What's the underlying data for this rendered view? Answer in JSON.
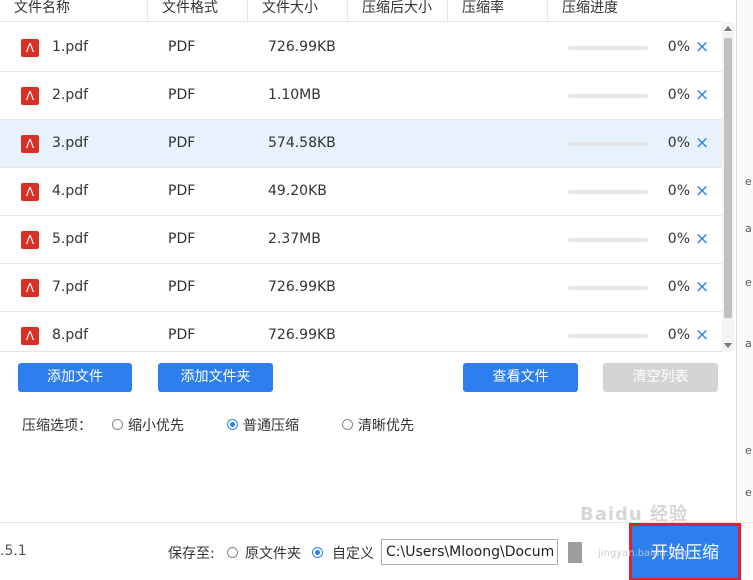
{
  "table": {
    "headers": [
      "文件名称",
      "文件格式",
      "文件大小",
      "压缩后大小",
      "压缩率",
      "压缩进度"
    ],
    "rows": [
      {
        "icon": "pdf-icon",
        "name": "1.pdf",
        "format": "PDF",
        "size": "726.99KB",
        "progress": "0%",
        "selected": false
      },
      {
        "icon": "pdf-icon",
        "name": "2.pdf",
        "format": "PDF",
        "size": "1.10MB",
        "progress": "0%",
        "selected": false
      },
      {
        "icon": "pdf-icon",
        "name": "3.pdf",
        "format": "PDF",
        "size": "574.58KB",
        "progress": "0%",
        "selected": true
      },
      {
        "icon": "pdf-icon",
        "name": "4.pdf",
        "format": "PDF",
        "size": "49.20KB",
        "progress": "0%",
        "selected": false
      },
      {
        "icon": "pdf-icon",
        "name": "5.pdf",
        "format": "PDF",
        "size": "2.37MB",
        "progress": "0%",
        "selected": false
      },
      {
        "icon": "pdf-icon",
        "name": "7.pdf",
        "format": "PDF",
        "size": "726.99KB",
        "progress": "0%",
        "selected": false
      },
      {
        "icon": "pdf-icon",
        "name": "8.pdf",
        "format": "PDF",
        "size": "726.99KB",
        "progress": "0%",
        "selected": false
      }
    ],
    "remove_icon": "×"
  },
  "buttons": {
    "add_file": "添加文件",
    "add_folder": "添加文件夹",
    "view_files": "查看文件",
    "clear_list": "清空列表"
  },
  "options": {
    "label": "压缩选项：",
    "items": [
      {
        "label": "缩小优先",
        "checked": false
      },
      {
        "label": "普通压缩",
        "checked": true
      },
      {
        "label": "清晰优先",
        "checked": false
      }
    ]
  },
  "footer": {
    "version": ".5.1",
    "save_to_label": "保存至:",
    "save_options": [
      {
        "label": "原文件夹",
        "checked": false
      },
      {
        "label": "自定义",
        "checked": true
      }
    ],
    "path_value": "C:\\Users\\Mloong\\Documents",
    "start_button": "开始压缩"
  },
  "side_glyphs": [
    "e",
    "a",
    "e",
    "a",
    "e",
    "e"
  ],
  "watermark": {
    "text": "Baidu 经验",
    "sub": "jingyan.baidu.com"
  },
  "colors": {
    "accent": "#2d7ff0",
    "selected_row": "#e8f2fc",
    "pdf_icon": "#d93025",
    "highlight_border": "#e0202c",
    "disabled_button": "#d4d4d4"
  }
}
